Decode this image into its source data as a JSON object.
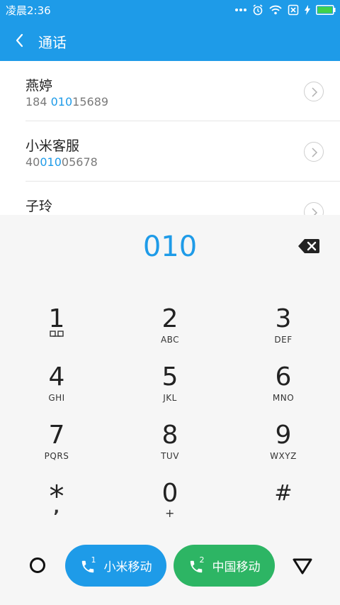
{
  "status": {
    "time": "凌晨2:36"
  },
  "header": {
    "title": "通话"
  },
  "results": [
    {
      "name": "燕婷",
      "number_parts": [
        "184 ",
        "010",
        "15689"
      ]
    },
    {
      "name": "小米客服",
      "number_parts": [
        "40",
        "010",
        "05678"
      ]
    },
    {
      "name": "子玲",
      "number_parts": [
        "",
        "",
        ""
      ]
    }
  ],
  "dial": {
    "input": "010"
  },
  "keypad": [
    {
      "digit": "1",
      "letters": ""
    },
    {
      "digit": "2",
      "letters": "ABC"
    },
    {
      "digit": "3",
      "letters": "DEF"
    },
    {
      "digit": "4",
      "letters": "GHI"
    },
    {
      "digit": "5",
      "letters": "JKL"
    },
    {
      "digit": "6",
      "letters": "MNO"
    },
    {
      "digit": "7",
      "letters": "PQRS"
    },
    {
      "digit": "8",
      "letters": "TUV"
    },
    {
      "digit": "9",
      "letters": "WXYZ"
    },
    {
      "digit": "*",
      "letters": ","
    },
    {
      "digit": "0",
      "letters": "+"
    },
    {
      "digit": "#",
      "letters": ""
    }
  ],
  "calls": {
    "sim1_label": "小米移动",
    "sim2_label": "中国移动",
    "sim1_num": "1",
    "sim2_num": "2"
  },
  "colors": {
    "accent": "#1e9be8",
    "green": "#2db564"
  }
}
